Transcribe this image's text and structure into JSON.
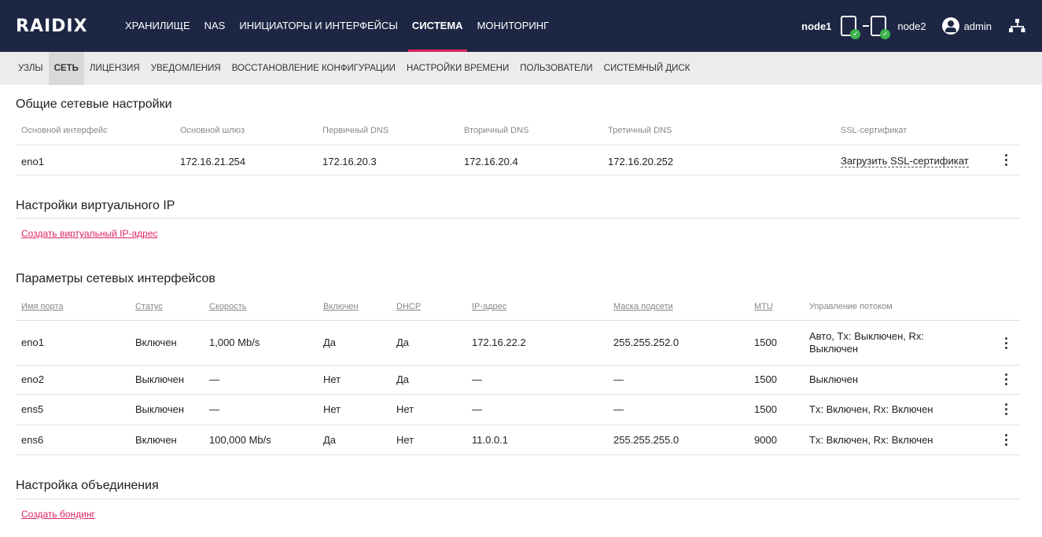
{
  "brand": {
    "logo": "RAIDIX"
  },
  "top_nav": {
    "items": [
      {
        "label": "ХРАНИЛИЩЕ",
        "active": false
      },
      {
        "label": "NAS",
        "active": false
      },
      {
        "label": "ИНИЦИАТОРЫ И ИНТЕРФЕЙСЫ",
        "active": false
      },
      {
        "label": "СИСТЕМА",
        "active": true
      },
      {
        "label": "МОНИТОРИНГ",
        "active": false
      }
    ]
  },
  "top_right": {
    "node1": "node1",
    "node2": "node2",
    "user": "admin"
  },
  "sub_nav": {
    "items": [
      {
        "label": "УЗЛЫ",
        "active": false
      },
      {
        "label": "СЕТЬ",
        "active": true
      },
      {
        "label": "ЛИЦЕНЗИЯ",
        "active": false
      },
      {
        "label": "УВЕДОМЛЕНИЯ",
        "active": false
      },
      {
        "label": "ВОССТАНОВЛЕНИЕ КОНФИГУРАЦИИ",
        "active": false
      },
      {
        "label": "НАСТРОЙКИ ВРЕМЕНИ",
        "active": false
      },
      {
        "label": "ПОЛЬЗОВАТЕЛИ",
        "active": false
      },
      {
        "label": "СИСТЕМНЫЙ ДИСК",
        "active": false
      }
    ]
  },
  "general": {
    "title": "Общие сетевые настройки",
    "headers": [
      "Основной интерфейс",
      "Основной шлюз",
      "Первичный DNS",
      "Вторичный DNS",
      "Третичный DNS",
      "SSL-сертификат"
    ],
    "row": [
      "eno1",
      "172.16.21.254",
      "172.16.20.3",
      "172.16.20.4",
      "172.16.20.252"
    ],
    "ssl_link": "Загрузить SSL-сертификат"
  },
  "virtual_ip": {
    "title": "Настройки виртуального IP",
    "create_link": "Создать виртуальный IP-адрес"
  },
  "interfaces": {
    "title": "Параметры сетевых интерфейсов",
    "headers": [
      "Имя порта",
      "Статус",
      "Скорость",
      "Включен",
      "DHCP",
      "IP-адрес",
      "Маска подсети",
      "MTU",
      "Управление потоком"
    ],
    "rows": [
      [
        "eno1",
        "Включен",
        "1,000 Mb/s",
        "Да",
        "Да",
        "172.16.22.2",
        "255.255.252.0",
        "1500",
        "Авто, Tx: Выключен, Rx: Выключен"
      ],
      [
        "eno2",
        "Выключен",
        "—",
        "Нет",
        "Да",
        "—",
        "—",
        "1500",
        "Выключен"
      ],
      [
        "ens5",
        "Выключен",
        "—",
        "Нет",
        "Нет",
        "—",
        "—",
        "1500",
        "Tx: Включен, Rx: Включен"
      ],
      [
        "ens6",
        "Включен",
        "100,000 Mb/s",
        "Да",
        "Нет",
        "11.0.0.1",
        "255.255.255.0",
        "9000",
        "Tx: Включен, Rx: Включен"
      ]
    ]
  },
  "bonding": {
    "title": "Настройка объединения",
    "create_link": "Создать бондинг"
  },
  "colors": {
    "header_bg": "#1d2744",
    "accent": "#e0245e",
    "status_ok": "#3db34a",
    "subnav_bg": "#ececec"
  },
  "icons": [
    "node-icon",
    "check-icon",
    "user-icon",
    "network-icon",
    "kebab-icon"
  ]
}
